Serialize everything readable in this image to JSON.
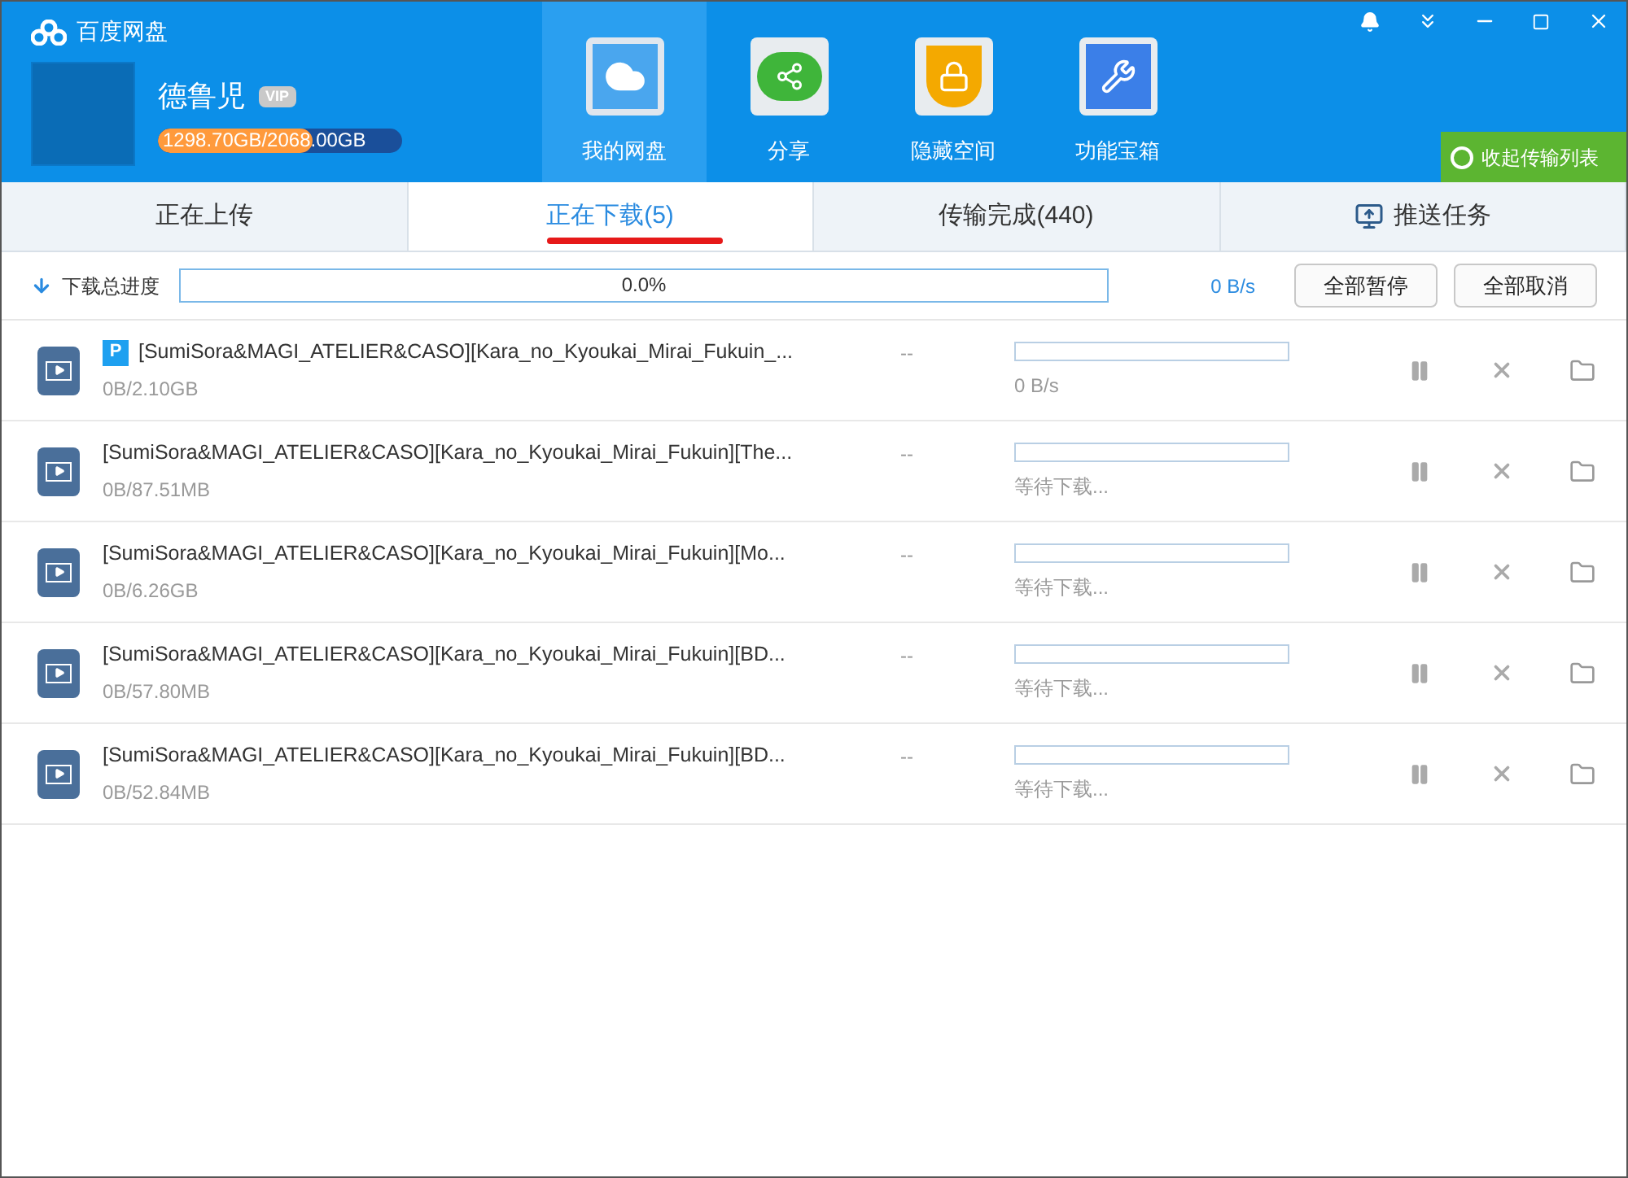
{
  "app": {
    "title": "百度网盘"
  },
  "user": {
    "name": "德鲁児",
    "badge": "VIP",
    "storage": "1298.70GB/2068.00GB",
    "level": 0.63
  },
  "nav": [
    {
      "label": "我的网盘",
      "kind": "cloud",
      "selected": true
    },
    {
      "label": "分享",
      "kind": "share",
      "selected": false
    },
    {
      "label": "隐藏空间",
      "kind": "lock",
      "selected": false
    },
    {
      "label": "功能宝箱",
      "kind": "tools",
      "selected": false
    }
  ],
  "collapse_button": "收起传输列表",
  "tabs": [
    {
      "label": "正在上传",
      "selected": false
    },
    {
      "label": "正在下载(5)",
      "selected": true
    },
    {
      "label": "传输完成(440)",
      "selected": false
    },
    {
      "label": "推送任务",
      "selected": false,
      "kind": "push"
    }
  ],
  "toolbar": {
    "label": "下载总进度",
    "progress": "0.0%",
    "level": 0,
    "speed": "0 B/s",
    "buttons": [
      "全部暂停",
      "全部取消"
    ]
  },
  "downloads": [
    {
      "badge": "P",
      "name": "[SumiSora&MAGI_ATELIER&CASO][Kara_no_Kyoukai_Mirai_Fukuin_...",
      "size": "0B/2.10GB",
      "time": "--",
      "level": 0,
      "status": "0 B/s"
    },
    {
      "name": "[SumiSora&MAGI_ATELIER&CASO][Kara_no_Kyoukai_Mirai_Fukuin][The...",
      "size": "0B/87.51MB",
      "time": "--",
      "level": 0,
      "status": "等待下载..."
    },
    {
      "name": "[SumiSora&MAGI_ATELIER&CASO][Kara_no_Kyoukai_Mirai_Fukuin][Mo...",
      "size": "0B/6.26GB",
      "time": "--",
      "level": 0,
      "status": "等待下载..."
    },
    {
      "name": "[SumiSora&MAGI_ATELIER&CASO][Kara_no_Kyoukai_Mirai_Fukuin][BD...",
      "size": "0B/57.80MB",
      "time": "--",
      "level": 0,
      "status": "等待下载..."
    },
    {
      "name": "[SumiSora&MAGI_ATELIER&CASO][Kara_no_Kyoukai_Mirai_Fukuin][BD...",
      "size": "0B/52.84MB",
      "time": "--",
      "level": 0,
      "status": "等待下载..."
    }
  ]
}
